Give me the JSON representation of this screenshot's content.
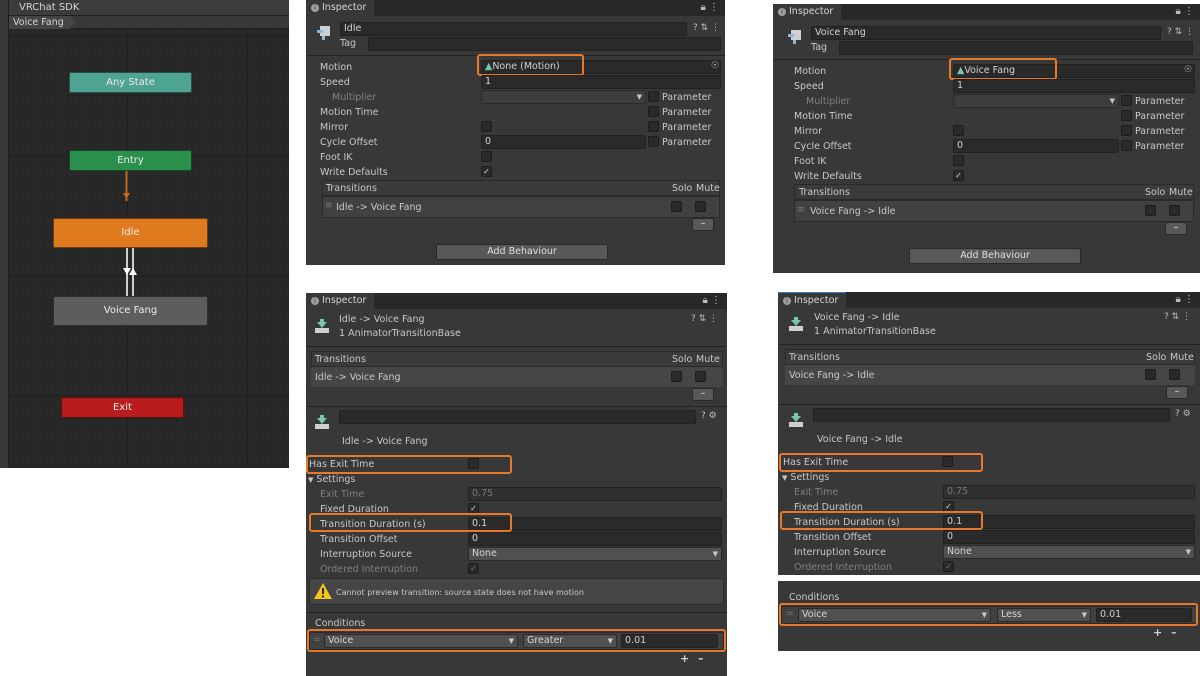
{
  "animator": {
    "title": "VRChat SDK",
    "breadcrumb": "Voice Fang",
    "nodes": {
      "any_state": "Any State",
      "entry": "Entry",
      "idle": "Idle",
      "voice_fang": "Voice Fang",
      "exit": "Exit"
    },
    "colors": {
      "any_state": "#4fa391",
      "entry": "#2b8f4e",
      "idle": "#e07a1f",
      "voice_fang": "#5d5d5d",
      "exit": "#b81c1c"
    }
  },
  "common": {
    "inspector_tab": "Inspector",
    "tag_label": "Tag",
    "motion_label": "Motion",
    "speed_label": "Speed",
    "multiplier_label": "Multiplier",
    "motion_time_label": "Motion Time",
    "mirror_label": "Mirror",
    "cycle_offset_label": "Cycle Offset",
    "foot_ik_label": "Foot IK",
    "write_defaults_label": "Write Defaults",
    "parameter_label": "Parameter",
    "transitions_label": "Transitions",
    "solo_label": "Solo",
    "mute_label": "Mute",
    "add_behaviour": "Add Behaviour",
    "has_exit_time": "Has Exit Time",
    "settings": "Settings",
    "exit_time": "Exit Time",
    "fixed_duration": "Fixed Duration",
    "transition_duration": "Transition Duration (s)",
    "transition_offset": "Transition Offset",
    "interruption_source": "Interruption Source",
    "ordered_interruption": "Ordered Interruption",
    "conditions": "Conditions",
    "highlight_color": "#e8782a"
  },
  "state_idle": {
    "name": "Idle",
    "motion": "None (Motion)",
    "speed": "1",
    "cycle_offset": "0",
    "transition": "Idle -> Voice Fang"
  },
  "state_voice": {
    "name": "Voice Fang",
    "motion": "Voice Fang",
    "speed": "1",
    "cycle_offset": "0",
    "transition": "Voice Fang -> Idle"
  },
  "trans_idle_voice": {
    "title": "Idle -> Voice Fang",
    "subtitle": "1 AnimatorTransitionBase",
    "list_item": "Idle -> Voice Fang",
    "detail_name": "Idle -> Voice Fang",
    "exit_time": "0.75",
    "transition_duration": "0.1",
    "transition_offset": "0",
    "interruption_source": "None",
    "warning": "Cannot preview transition: source state does not have motion",
    "condition": {
      "parameter": "Voice",
      "mode": "Greater",
      "threshold": "0.01"
    }
  },
  "trans_voice_idle": {
    "title": "Voice Fang -> Idle",
    "subtitle": "1 AnimatorTransitionBase",
    "list_item": "Voice Fang -> Idle",
    "detail_name": "Voice Fang -> Idle",
    "exit_time": "0.75",
    "transition_duration": "0.1",
    "transition_offset": "0",
    "interruption_source": "None",
    "condition": {
      "parameter": "Voice",
      "mode": "Less",
      "threshold": "0.01"
    }
  }
}
